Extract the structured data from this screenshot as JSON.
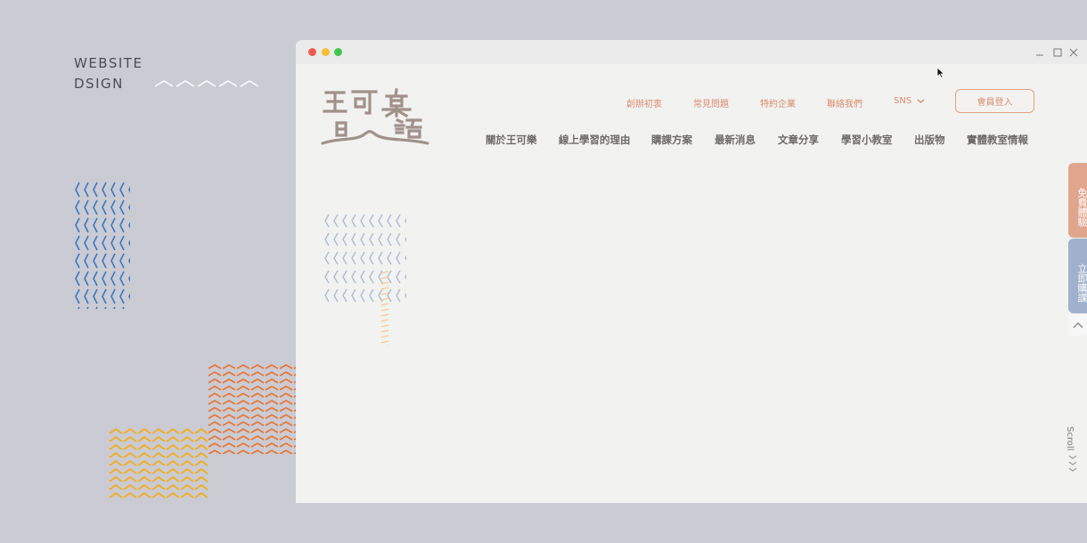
{
  "side_title": {
    "line1": "WEBSITE",
    "line2": "DSIGN"
  },
  "brand": {
    "logo_text": "王可樂日語",
    "accent": "#d98c6f",
    "secondary": "#9fb1cc"
  },
  "top_nav": [
    {
      "label": "創辦初衷"
    },
    {
      "label": "常見問題"
    },
    {
      "label": "特約企業"
    },
    {
      "label": "聯絡我們"
    },
    {
      "label": "SNS"
    }
  ],
  "login_button": "會員登入",
  "main_nav": [
    {
      "label": "關於王可樂"
    },
    {
      "label": "線上學習的理由"
    },
    {
      "label": "購課方案"
    },
    {
      "label": "最新消息"
    },
    {
      "label": "文章分享"
    },
    {
      "label": "學習小教室"
    },
    {
      "label": "出版物"
    },
    {
      "label": "實體教室情報"
    }
  ],
  "side_tabs": {
    "trial": "免費體驗",
    "buy": "立即購課"
  },
  "scroll_label": "Scroll",
  "icons": {
    "window_controls": [
      "close-dot",
      "minimize-dot",
      "zoom-dot"
    ],
    "titlebar": [
      "minimize-icon",
      "maximize-icon",
      "close-icon"
    ],
    "sns_dropdown": "chevron-down-icon",
    "back_to_top": "chevron-up-icon",
    "scroll_hint": "chevron-right-icon"
  }
}
